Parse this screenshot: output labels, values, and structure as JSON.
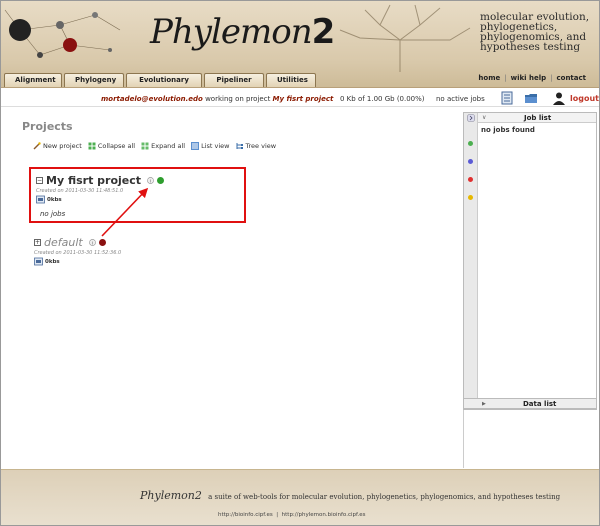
{
  "header": {
    "logo_text": "Phylemon",
    "logo_num": "2",
    "tagline": [
      "molecular evolution,",
      "phylogenetics,",
      "phylogenomics, and",
      "hypotheses testing"
    ],
    "tabs": [
      "Alignment",
      "Phylogeny",
      "Evolutionary tests",
      "Pipeliner",
      "Utilities"
    ],
    "links": [
      "home",
      "wiki help",
      "contact"
    ]
  },
  "userbar": {
    "user": "mortadelo@evolution.edo",
    "working_text": " working on project ",
    "project": "My fisrt project",
    "quota": "0 Kb of 1.00 Gb (0.00%)",
    "active_jobs": "no active jobs",
    "logout": "logout"
  },
  "main": {
    "title": "Projects",
    "actions": [
      "New project",
      "Collapse all",
      "Expand all",
      "List view",
      "Tree view"
    ],
    "projects": [
      {
        "name": "My fisrt project",
        "created": "Created on 2011-03-30 11:48:51.0",
        "size": "0kbs",
        "jobs": "no jobs",
        "toggle": "−"
      },
      {
        "name": "default",
        "created": "Created on 2011-03-30 11:52:36.0",
        "size": "0kbs",
        "toggle": "+"
      }
    ]
  },
  "panel": {
    "job_list_title": "Job list",
    "job_list_empty": "no jobs found",
    "data_list_title": "Data list"
  },
  "footer": {
    "logo": "Phylemon2",
    "text": "a suite of web-tools for molecular evolution, phylogenetics, phylogenomics, and hypotheses testing",
    "url1": "http://bioinfo.cipf.es",
    "sep": "|",
    "url2": "http://phylemon.bioinfo.cipf.es"
  },
  "colors": {
    "accent_red": "#e01010",
    "user_text": "#8b1a00",
    "status_green": "#2e9e2e",
    "status_darkred": "#8a1010"
  }
}
